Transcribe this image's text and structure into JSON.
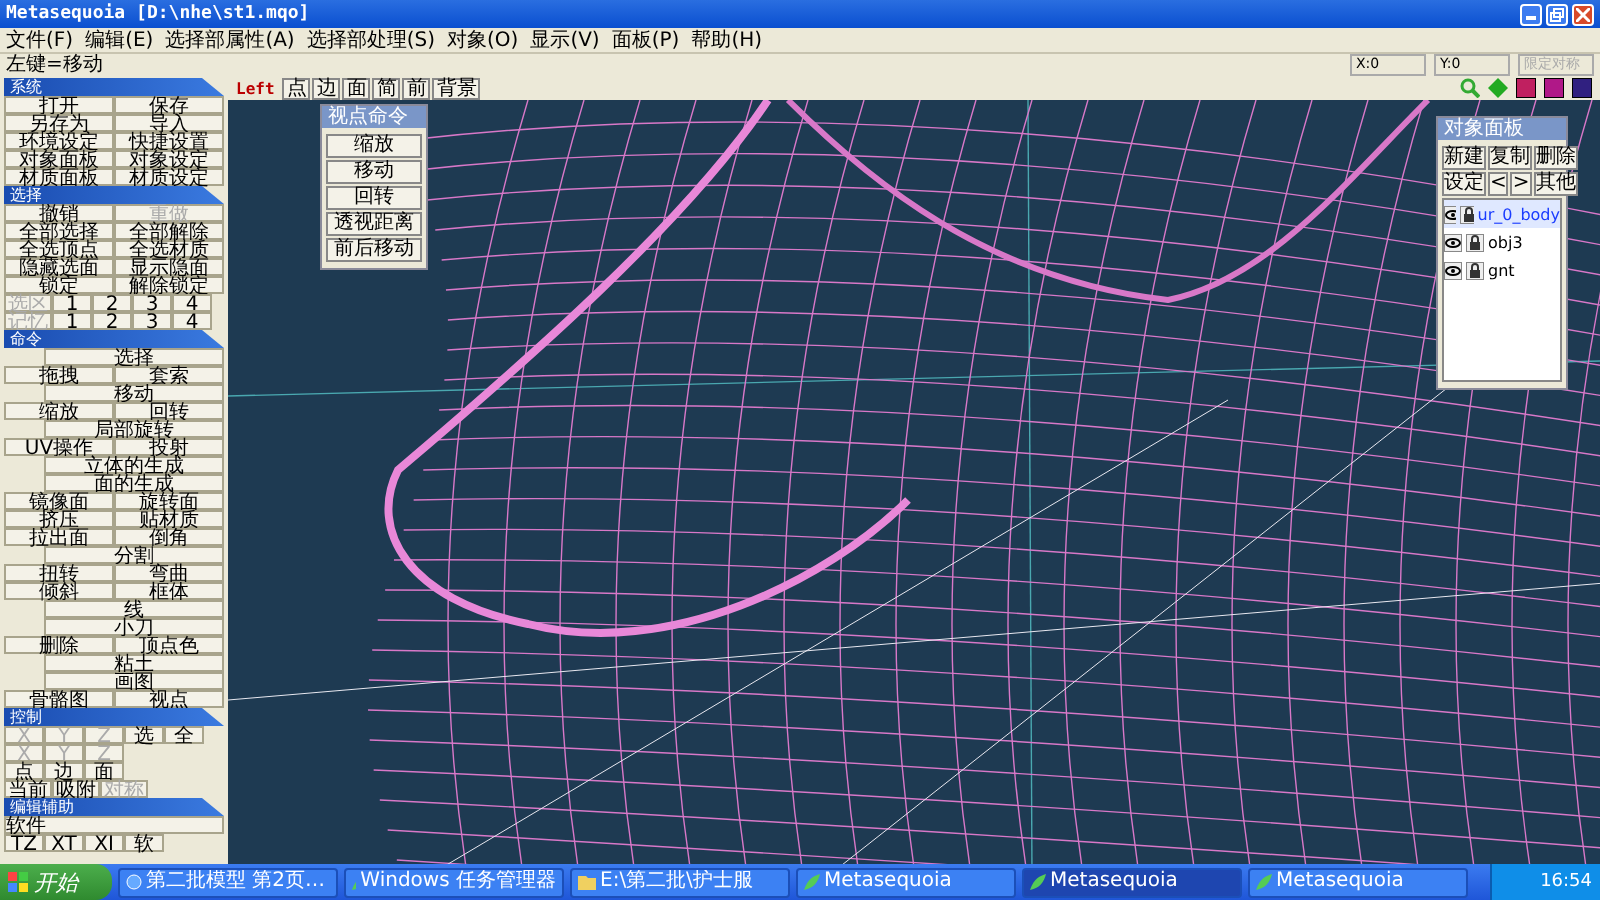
{
  "window": {
    "title": "Metasequoia [D:\\nhe\\st1.mqo]"
  },
  "menu": [
    "文件(F)",
    "编辑(E)",
    "选择部属性(A)",
    "选择部处理(S)",
    "对象(O)",
    "显示(V)",
    "面板(P)",
    "帮助(H)"
  ],
  "status": {
    "hint": "左键=移动",
    "fields": [
      "X:0",
      "Y:0",
      "限定对称"
    ]
  },
  "panels": [
    {
      "title": "系统",
      "rows": [
        [
          {
            "label": "打开",
            "disabled": false
          },
          {
            "label": "保存",
            "disabled": false
          }
        ],
        [
          {
            "label": "另存为",
            "disabled": false
          },
          {
            "label": "导入",
            "disabled": false
          }
        ],
        [
          {
            "label": "环境设定",
            "disabled": false
          },
          {
            "label": "快捷设置",
            "disabled": false
          }
        ],
        [
          {
            "label": "对象面板",
            "disabled": false
          },
          {
            "label": "对象设定",
            "disabled": false
          }
        ],
        [
          {
            "label": "材质面板",
            "disabled": false
          },
          {
            "label": "材质设定",
            "disabled": false
          }
        ]
      ]
    },
    {
      "title": "选择",
      "rows": [
        [
          {
            "label": "撤销",
            "disabled": false
          },
          {
            "label": "重做",
            "disabled": true
          }
        ],
        [
          {
            "label": "全部选择",
            "disabled": false
          },
          {
            "label": "全部解除",
            "disabled": false
          }
        ],
        [
          {
            "label": "全选顶点",
            "disabled": false
          },
          {
            "label": "全选材质",
            "disabled": false
          }
        ],
        [
          {
            "label": "隐藏选面",
            "disabled": false
          },
          {
            "label": "显示隐面",
            "disabled": false
          }
        ],
        [
          {
            "label": "锁定",
            "disabled": false
          },
          {
            "label": "解除锁定",
            "disabled": false
          }
        ],
        [
          {
            "label": "选区",
            "disabled": true
          },
          {
            "label": "1",
            "disabled": false
          },
          {
            "label": "2",
            "disabled": false
          },
          {
            "label": "3",
            "disabled": false
          },
          {
            "label": "4",
            "disabled": false
          }
        ],
        [
          {
            "label": "记忆",
            "disabled": true
          },
          {
            "label": "1",
            "disabled": false
          },
          {
            "label": "2",
            "disabled": false
          },
          {
            "label": "3",
            "disabled": false
          },
          {
            "label": "4",
            "disabled": false
          }
        ]
      ]
    },
    {
      "title": "命令",
      "rows": [
        [
          {
            "label": "选择",
            "disabled": false
          }
        ],
        [
          {
            "label": "拖拽",
            "disabled": false
          },
          {
            "label": "套索",
            "disabled": false
          }
        ],
        [
          {
            "label": "移动",
            "disabled": false
          }
        ],
        [
          {
            "label": "缩放",
            "disabled": false
          },
          {
            "label": "回转",
            "disabled": false
          }
        ],
        [
          {
            "label": "局部旋转",
            "disabled": false
          }
        ],
        [
          {
            "label": "UV操作",
            "disabled": false
          },
          {
            "label": "投射",
            "disabled": false
          }
        ],
        [
          {
            "label": "立体的生成",
            "disabled": false
          }
        ],
        [
          {
            "label": "面的生成",
            "disabled": false
          }
        ],
        [
          {
            "label": "镜像面",
            "disabled": false
          },
          {
            "label": "旋转面",
            "disabled": false
          }
        ],
        [
          {
            "label": "挤压",
            "disabled": false
          },
          {
            "label": "贴材质",
            "disabled": false
          }
        ],
        [
          {
            "label": "拉出面",
            "disabled": false
          },
          {
            "label": "倒角",
            "disabled": false
          }
        ],
        [
          {
            "label": "分割",
            "disabled": false
          }
        ],
        [
          {
            "label": "扭转",
            "disabled": false
          },
          {
            "label": "弯曲",
            "disabled": false
          }
        ],
        [
          {
            "label": "倾斜",
            "disabled": false
          },
          {
            "label": "框体",
            "disabled": false
          }
        ],
        [
          {
            "label": "线",
            "disabled": false
          }
        ],
        [
          {
            "label": "小刀",
            "disabled": false
          }
        ],
        [
          {
            "label": "删除",
            "disabled": false
          },
          {
            "label": "顶点色",
            "disabled": false
          }
        ],
        [
          {
            "label": "粘土",
            "disabled": false
          }
        ],
        [
          {
            "label": "画图",
            "disabled": false
          }
        ],
        [
          {
            "label": "骨骼图",
            "disabled": false
          },
          {
            "label": "视点",
            "disabled": false
          }
        ]
      ]
    },
    {
      "title": "控制",
      "rows": [
        [
          {
            "label": "X",
            "disabled": true
          },
          {
            "label": "Y",
            "disabled": true
          },
          {
            "label": "Z",
            "disabled": true
          },
          {
            "label": "选",
            "disabled": false
          },
          {
            "label": "全",
            "disabled": false
          }
        ],
        [
          {
            "label": "X",
            "disabled": true
          },
          {
            "label": "Y",
            "disabled": true
          },
          {
            "label": "Z",
            "disabled": true
          }
        ],
        [
          {
            "label": "点",
            "disabled": false
          },
          {
            "label": "边",
            "disabled": false
          },
          {
            "label": "面",
            "disabled": false
          }
        ],
        [
          {
            "label": "当前",
            "disabled": false
          },
          {
            "label": "吸附",
            "disabled": false
          },
          {
            "label": "对称",
            "disabled": true
          }
        ]
      ]
    },
    {
      "title": "编辑辅助",
      "rows": [
        [
          {
            "label": "软件",
            "disabled": false
          }
        ],
        [
          {
            "label": "TZ",
            "disabled": false
          },
          {
            "label": "XT",
            "disabled": false
          },
          {
            "label": "XI",
            "disabled": false
          },
          {
            "label": "软",
            "disabled": false
          }
        ]
      ]
    }
  ],
  "view_toolbar": [
    {
      "label": "Left",
      "kind": "label"
    },
    {
      "label": "点",
      "kind": "button"
    },
    {
      "label": "边",
      "kind": "button"
    },
    {
      "label": "面",
      "kind": "button"
    },
    {
      "label": "简",
      "kind": "button"
    },
    {
      "label": "前",
      "kind": "button"
    },
    {
      "label": "背景",
      "kind": "button"
    }
  ],
  "viewpoint_panel": {
    "title": "视点命令",
    "buttons": [
      "缩放",
      "移动",
      "回转",
      "透视距离",
      "前后移动"
    ]
  },
  "object_panel": {
    "title": "对象面板",
    "buttons": [
      [
        "新建",
        "复制",
        "删除"
      ],
      [
        "设定",
        "<",
        ">",
        "其他"
      ]
    ],
    "objects": [
      {
        "name": "ur_0_body",
        "selected": true
      },
      {
        "name": "obj3",
        "selected": false
      },
      {
        "name": "gnt",
        "selected": false
      }
    ]
  },
  "taskbar": {
    "start": "开始",
    "items": [
      {
        "label": "第二批模型 第2页…",
        "kind": "browser",
        "selected": false
      },
      {
        "label": "Windows 任务管理器",
        "kind": "app",
        "selected": false
      },
      {
        "label": "E:\\第二批\\护士服",
        "kind": "folder",
        "selected": false
      },
      {
        "label": "Metasequoia",
        "kind": "app",
        "selected": false
      },
      {
        "label": "Metasequoia",
        "kind": "app",
        "selected": true
      },
      {
        "label": "Metasequoia",
        "kind": "app",
        "selected": false
      }
    ],
    "clock": "16:54"
  }
}
